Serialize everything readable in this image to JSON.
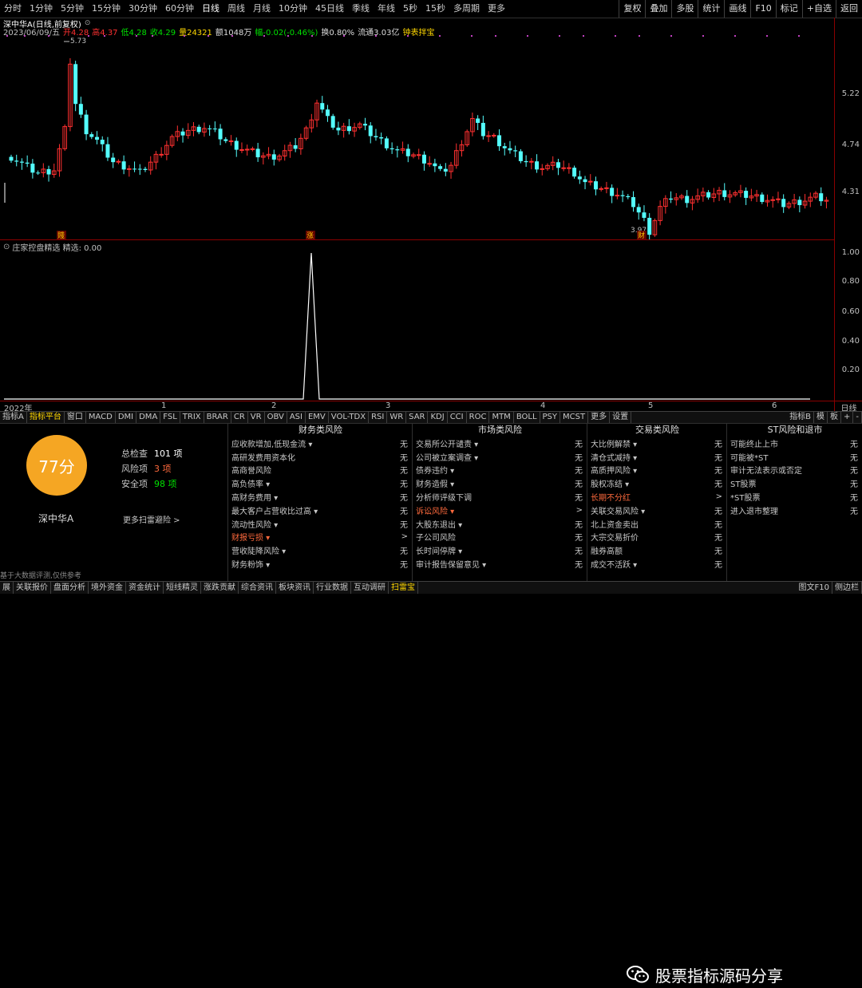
{
  "top": {
    "timeframes": [
      "分时",
      "1分钟",
      "5分钟",
      "15分钟",
      "30分钟",
      "60分钟",
      "日线",
      "周线",
      "月线",
      "10分钟",
      "45日线",
      "季线",
      "年线",
      "5秒",
      "15秒",
      "多周期",
      "更多"
    ],
    "active": "日线",
    "right_buttons": [
      "复权",
      "叠加",
      "多股",
      "统计",
      "画线",
      "F10",
      "标记",
      "+自选",
      "返回"
    ]
  },
  "info": {
    "title": "深中华A(日线,前复权)",
    "date": "2023/06/09/五",
    "open": "开4.28",
    "high": "高4.37",
    "low": "低4.28",
    "close": "收4.29",
    "volume": "量24321",
    "amount": "额1048万",
    "change": "幅-0.02(-0.46%)",
    "turnover": "换0.80%",
    "float": "流通3.03亿",
    "extra": "钟表拌宝"
  },
  "main_axis": [
    "5.22",
    "4.74",
    "4.31"
  ],
  "price_labels": {
    "high": "5.73",
    "low": "3.97"
  },
  "markers": {
    "m1": "賤",
    "m2": "涨",
    "m3": "财"
  },
  "indicator": {
    "header": "庄家控盘精选  精选: 0.00",
    "axis": [
      "1.00",
      "0.80",
      "0.60",
      "0.40",
      "0.20"
    ]
  },
  "date_axis": [
    "2022年",
    "1",
    "2",
    "3",
    "4",
    "5",
    "6"
  ],
  "date_axis_right": "日线",
  "ind_tabs": [
    "指标A",
    "指标平台",
    "窗口",
    "MACD",
    "DMI",
    "DMA",
    "FSL",
    "TRIX",
    "BRAR",
    "CR",
    "VR",
    "OBV",
    "ASI",
    "EMV",
    "VOL-TDX",
    "RSI",
    "WR",
    "SAR",
    "KDJ",
    "CCI",
    "ROC",
    "MTM",
    "BOLL",
    "PSY",
    "MCST",
    "更多",
    "设置"
  ],
  "ind_tabs_right": [
    "指标B",
    "模",
    "板",
    "+",
    "-"
  ],
  "risk": {
    "score": "77分",
    "name": "深中华A",
    "total_label": "总检查",
    "total_value": "101 项",
    "risk_label": "风险项",
    "risk_value": "3 项",
    "safe_label": "安全项",
    "safe_value": "98 项",
    "more_scan": "更多扫雷避险 >",
    "foot_note": "基于大数据评测,仅供参考",
    "columns": [
      {
        "title": "财务类风险",
        "items": [
          {
            "label": "应收款增加,低现金流 ▾",
            "status": "无"
          },
          {
            "label": "高研发费用资本化",
            "status": "无"
          },
          {
            "label": "高商誉风险",
            "status": "无"
          },
          {
            "label": "高负债率 ▾",
            "status": "无"
          },
          {
            "label": "高财务费用 ▾",
            "status": "无"
          },
          {
            "label": "最大客户占营收比过高 ▾",
            "status": "无"
          },
          {
            "label": "流动性风险 ▾",
            "status": "无"
          },
          {
            "label": "财报亏损 ▾",
            "status": ">",
            "hl": true
          },
          {
            "label": "营收陡降风险 ▾",
            "status": "无"
          },
          {
            "label": "财务粉饰 ▾",
            "status": "无"
          }
        ]
      },
      {
        "title": "市场类风险",
        "items": [
          {
            "label": "交易所公开谴责 ▾",
            "status": "无"
          },
          {
            "label": "公司被立案调查 ▾",
            "status": "无"
          },
          {
            "label": "债券违约 ▾",
            "status": "无"
          },
          {
            "label": "财务造假 ▾",
            "status": "无"
          },
          {
            "label": "分析师评级下调",
            "status": "无"
          },
          {
            "label": "诉讼风险 ▾",
            "status": ">",
            "hl": true
          },
          {
            "label": "大股东退出 ▾",
            "status": "无"
          },
          {
            "label": "子公司风险",
            "status": "无"
          },
          {
            "label": "长时间停牌 ▾",
            "status": "无"
          },
          {
            "label": "审计报告保留意见 ▾",
            "status": "无"
          }
        ]
      },
      {
        "title": "交易类风险",
        "items": [
          {
            "label": "大比例解禁 ▾",
            "status": "无"
          },
          {
            "label": "清仓式减持 ▾",
            "status": "无"
          },
          {
            "label": "高质押风险 ▾",
            "status": "无"
          },
          {
            "label": "股权冻结 ▾",
            "status": "无"
          },
          {
            "label": "长期不分红",
            "status": ">",
            "hl": true
          },
          {
            "label": "关联交易风险 ▾",
            "status": "无"
          },
          {
            "label": "北上资金卖出",
            "status": "无"
          },
          {
            "label": "大宗交易折价",
            "status": "无"
          },
          {
            "label": "融券高额",
            "status": "无"
          },
          {
            "label": "成交不活跃 ▾",
            "status": "无"
          }
        ]
      },
      {
        "title": "ST风险和退市",
        "items": [
          {
            "label": "可能终止上市",
            "status": "无"
          },
          {
            "label": "可能被*ST",
            "status": "无"
          },
          {
            "label": "审计无法表示或否定",
            "status": "无"
          },
          {
            "label": "ST股票",
            "status": "无"
          },
          {
            "label": "*ST股票",
            "status": "无"
          },
          {
            "label": "进入退市整理",
            "status": "无"
          }
        ]
      }
    ]
  },
  "bottom_tabs": [
    "展",
    "关联报价",
    "盘面分析",
    "境外资金",
    "资金统计",
    "短线精灵",
    "涨跌贡献",
    "综合资讯",
    "板块资讯",
    "行业数据",
    "互动调研",
    "扫雷宝"
  ],
  "bottom_active": "扫雷宝",
  "bottom_right": [
    "图文F10",
    "侧边栏"
  ],
  "watermark": "股票指标源码分享",
  "colors": {
    "up": "#ff3030",
    "down": "#54ffff",
    "score": "#f5a623",
    "highlight": "#ff6a3d"
  }
}
